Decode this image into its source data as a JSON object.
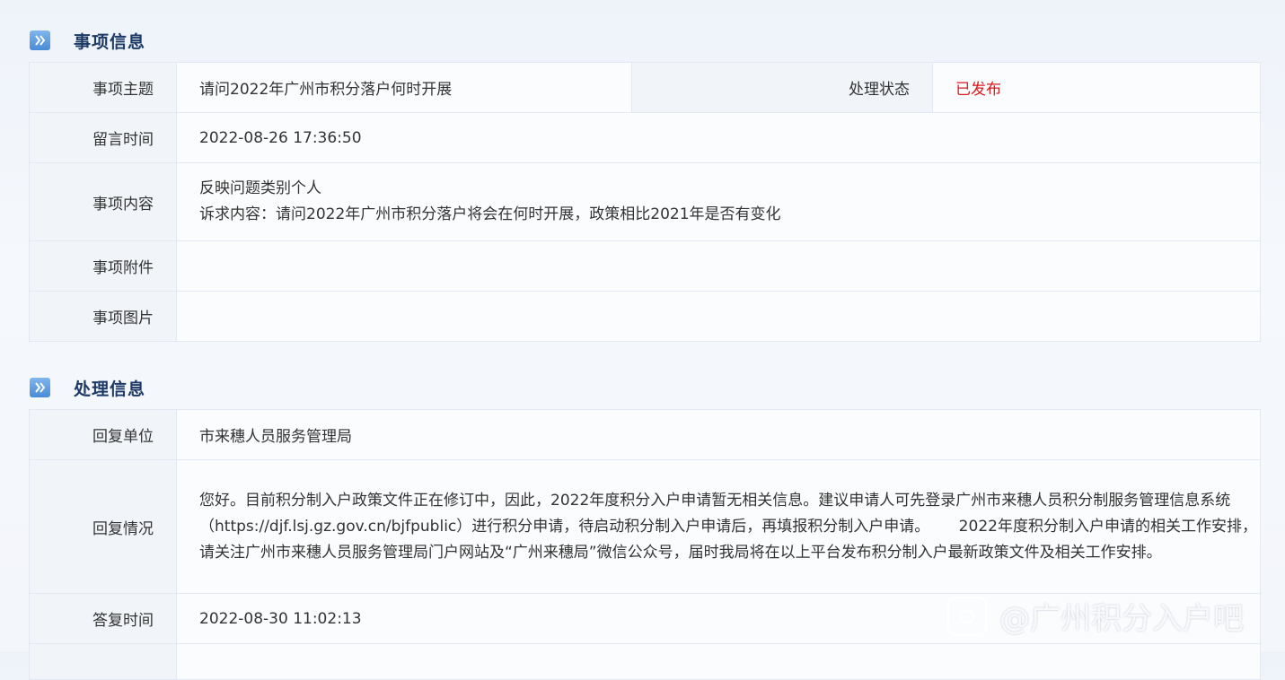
{
  "matter_section": {
    "title": "事项信息",
    "rows": {
      "subject_label": "事项主题",
      "subject_value": "请问2022年广州市积分落户何时开展",
      "status_label": "处理状态",
      "status_value": "已发布",
      "message_time_label": "留言时间",
      "message_time_value": "2022-08-26 17:36:50",
      "content_label": "事项内容",
      "content_line1": "反映问题类别个人",
      "content_line2": "诉求内容：请问2022年广州市积分落户将会在何时开展，政策相比2021年是否有变化",
      "attachment_label": "事项附件",
      "attachment_value": "",
      "image_label": "事项图片",
      "image_value": ""
    }
  },
  "processing_section": {
    "title": "处理信息",
    "rows": {
      "reply_unit_label": "回复单位",
      "reply_unit_value": "市来穗人员服务管理局",
      "reply_status_label": "回复情况",
      "reply_status_value": "您好。目前积分制入户政策文件正在修订中，因此，2022年度积分入户申请暂无相关信息。建议申请人可先登录广州市来穗人员积分制服务管理信息系统（https://djf.lsj.gz.gov.cn/bjfpublic）进行积分申请，待启动积分制入户申请后，再填报积分制入户申请。      2022年度积分制入户申请的相关工作安排，请关注广州市来穗人员服务管理局门户网站及“广州来穗局”微信公众号，届时我局将在以上平台发布积分制入户最新政策文件及相关工作安排。",
      "reply_time_label": "答复时间",
      "reply_time_value": "2022-08-30 11:02:13"
    }
  },
  "watermark": {
    "text": "@广州积分入户吧"
  },
  "colors": {
    "status_red": "#d9191b",
    "section_title": "#1d3a66",
    "icon_blue": "#4a8bd6"
  }
}
